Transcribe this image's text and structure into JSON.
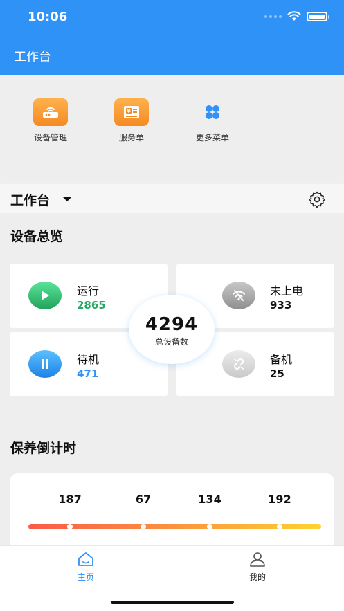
{
  "status_bar": {
    "time": "10:06"
  },
  "header": {
    "title": "工作台"
  },
  "quick_actions": [
    {
      "label": "设备管理",
      "icon": "router-icon"
    },
    {
      "label": "服务单",
      "icon": "invoice-icon"
    },
    {
      "label": "更多菜单",
      "icon": "grid-menu-icon"
    }
  ],
  "workbench": {
    "title": "工作台"
  },
  "overview": {
    "title": "设备总览",
    "running": {
      "label": "运行",
      "value": "2865"
    },
    "unpowered": {
      "label": "未上电",
      "value": "933"
    },
    "standby": {
      "label": "待机",
      "value": "471"
    },
    "backup": {
      "label": "备机",
      "value": "25"
    },
    "total": {
      "value": "4294",
      "label": "总设备数"
    }
  },
  "maintenance": {
    "title": "保养倒计时",
    "values": [
      "187",
      "67",
      "134",
      "192"
    ]
  },
  "tabbar": {
    "home": "主页",
    "mine": "我的"
  },
  "colors": {
    "primary": "#2f92f6",
    "running_green": "#2aa866",
    "standby_blue": "#2f92f6"
  }
}
